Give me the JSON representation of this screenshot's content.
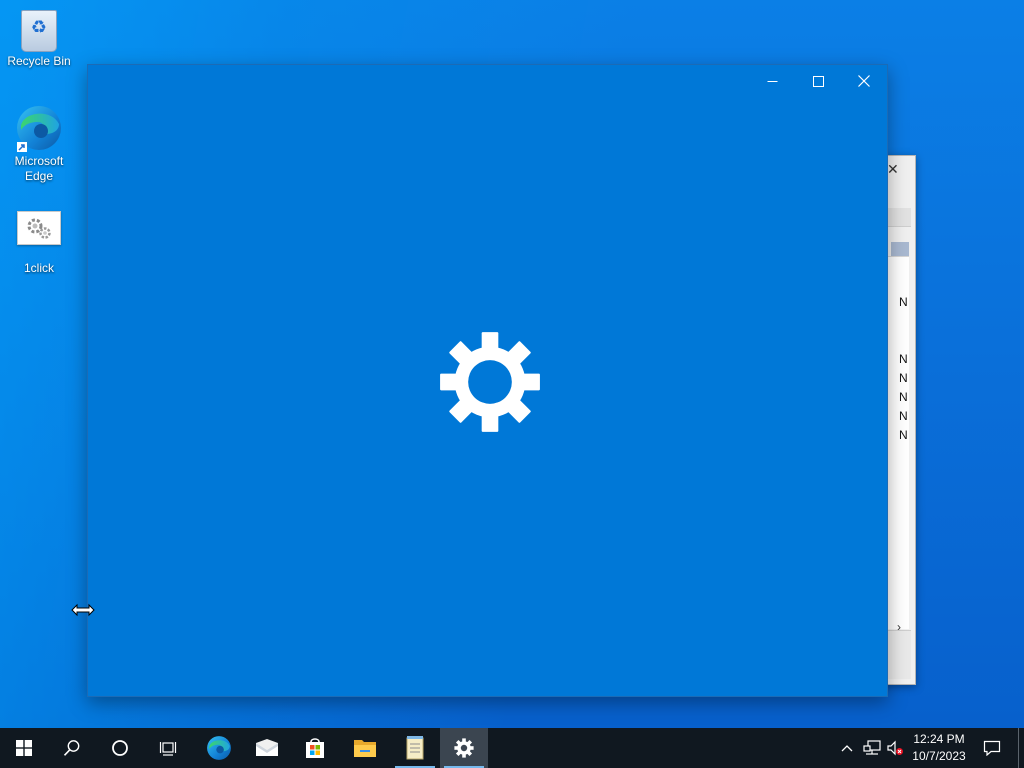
{
  "desktop": {
    "icons": [
      {
        "label": "Recycle Bin"
      },
      {
        "label": "Microsoft Edge"
      },
      {
        "label": "1click"
      }
    ]
  },
  "background_window": {
    "cells": [
      "N",
      "N",
      "N",
      "N",
      "N",
      "N"
    ]
  },
  "settings_window": {
    "splash_icon": "gear-icon",
    "caption_buttons": [
      "minimize",
      "maximize",
      "close"
    ]
  },
  "taskbar": {
    "buttons": [
      "start",
      "search",
      "cortana",
      "task-view",
      "microsoft-edge",
      "mail",
      "microsoft-store",
      "file-explorer",
      "notepad",
      "settings"
    ],
    "active": "settings",
    "tray": {
      "time": "12:24 PM",
      "date": "10/7/2023"
    }
  },
  "colors": {
    "accent": "#0078d7",
    "taskbar": "#101820"
  }
}
